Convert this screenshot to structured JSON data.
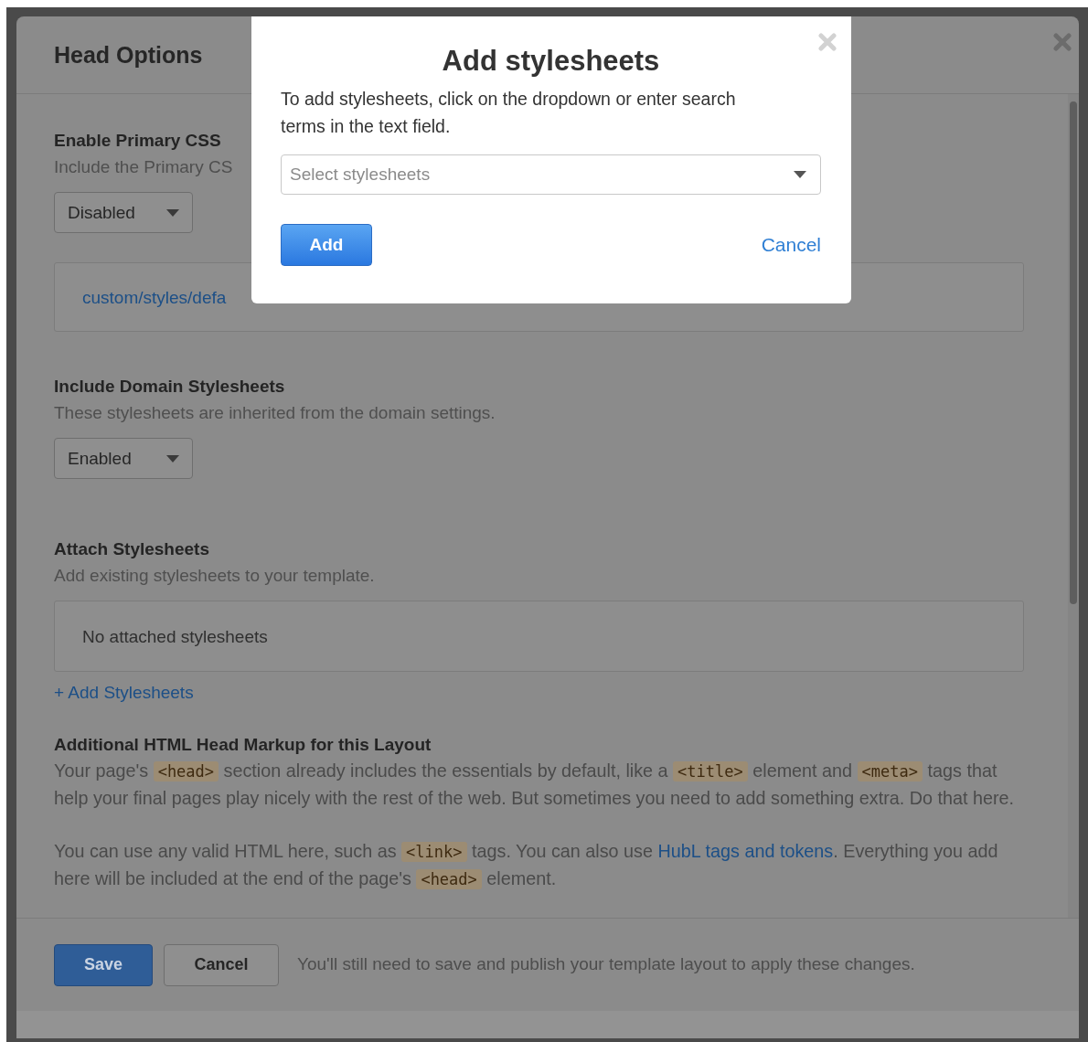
{
  "main_dialog": {
    "title": "Head Options"
  },
  "sections": [
    {
      "kind": "toggle",
      "heading": "Enable Primary CSS",
      "description": "Include the Primary CS",
      "select": {
        "value": "Disabled"
      },
      "file_link": "custom/styles/defa"
    },
    {
      "kind": "toggle",
      "heading": "Include Domain Stylesheets",
      "description": "These stylesheets are inherited from the domain settings.",
      "select": {
        "value": "Enabled"
      }
    },
    {
      "kind": "attach",
      "heading": "Attach Stylesheets",
      "description": "Add existing stylesheets to your template.",
      "empty_message": "No attached stylesheets",
      "add_link": "+ Add Stylesheets"
    },
    {
      "kind": "markup",
      "heading": "Additional HTML Head Markup for this Layout",
      "paragraphs": [
        [
          {
            "kind": "text",
            "text": "Your page's "
          },
          {
            "kind": "code",
            "text": "<head>"
          },
          {
            "kind": "text",
            "text": " section already includes the essentials by default, like a "
          },
          {
            "kind": "code",
            "text": "<title>"
          },
          {
            "kind": "text",
            "text": " element and "
          },
          {
            "kind": "code",
            "text": "<meta>"
          },
          {
            "kind": "text",
            "text": " tags that help your final pages play nicely with the rest of the web. But sometimes you need to add something extra. Do that here."
          }
        ],
        [
          {
            "kind": "text",
            "text": "You can use any valid HTML here, such as "
          },
          {
            "kind": "code",
            "text": "<link>"
          },
          {
            "kind": "text",
            "text": " tags. You can also use "
          },
          {
            "kind": "link",
            "text": "HubL tags and tokens"
          },
          {
            "kind": "text",
            "text": ". Everything you add here will be included at the end of the page's "
          },
          {
            "kind": "code",
            "text": "<head>"
          },
          {
            "kind": "text",
            "text": " element."
          }
        ]
      ]
    }
  ],
  "footer": {
    "buttons": [
      {
        "label": "Save",
        "kind": "primary"
      },
      {
        "label": "Cancel",
        "kind": "secondary"
      }
    ],
    "note": "You'll still need to save and publish your template layout to apply these changes."
  },
  "add_dialog": {
    "title": "Add stylesheets",
    "instructions": "To add stylesheets, click on the dropdown or enter search terms in the text field.",
    "select": {
      "placeholder": "Select stylesheets"
    },
    "add_button": "Add",
    "cancel_link": "Cancel"
  }
}
